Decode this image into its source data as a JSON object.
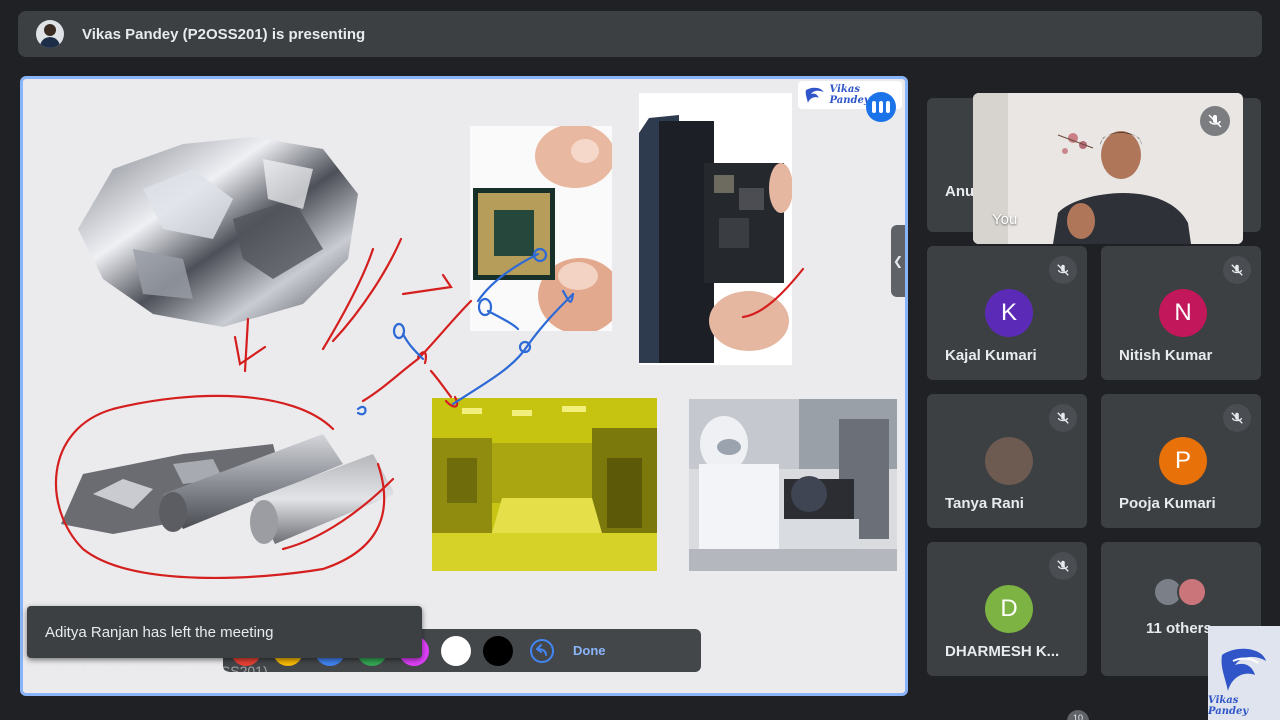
{
  "header": {
    "presenting_text": "Vikas Pandey (P2OSS201) is presenting"
  },
  "presentation": {
    "logo_text": "Vikas Pandey",
    "footer_name": "Vikas Pandey (P2OSS201)",
    "toast_message": "Aditya Ranjan has left the meeting",
    "pen_toolbar": {
      "colors": [
        "#ea4335",
        "#fbbc04",
        "#4285f4",
        "#34a853",
        "#e040fb",
        "#ffffff",
        "#000000"
      ],
      "done_label": "Done"
    }
  },
  "participants": {
    "self_label": "You",
    "partial_name": "Anu",
    "tiles": [
      {
        "name": "Kajal Kumari",
        "initial": "K",
        "color": "#5b2bb8",
        "muted": true
      },
      {
        "name": "Nitish Kumar",
        "initial": "N",
        "color": "#c2185b",
        "muted": true
      },
      {
        "name": "Tanya Rani",
        "initial": "",
        "color": "#6d5a50",
        "muted": true
      },
      {
        "name": "Pooja Kumari",
        "initial": "P",
        "color": "#e8710a",
        "muted": true
      },
      {
        "name": "DHARMESH K...",
        "initial": "D",
        "color": "#7cb342",
        "muted": true
      }
    ],
    "others_label": "11 others",
    "count_badge": "10"
  },
  "watermark": {
    "text": "Vikas Pandey"
  },
  "icons": {
    "mute": "mic-off-icon",
    "pin": "pin-icon",
    "undo": "undo-icon",
    "collapse": "chevron-left-icon"
  }
}
